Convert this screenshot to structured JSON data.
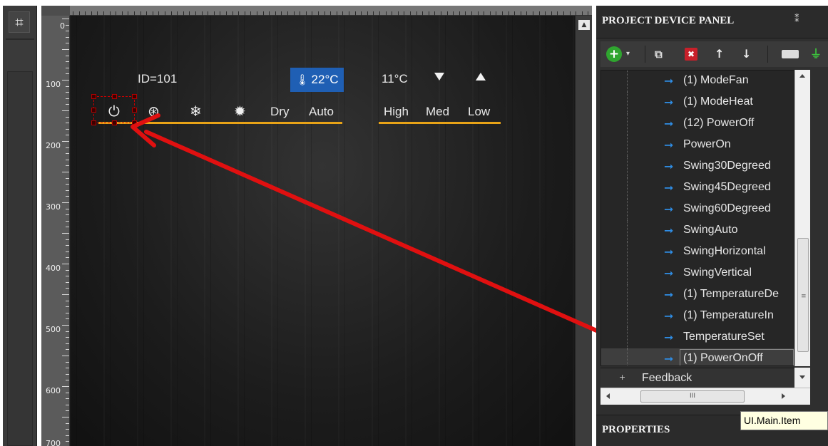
{
  "left_toolbar": {
    "fit_icon": "fit-to-screen-icon"
  },
  "ruler": {
    "zero": "0",
    "marks": [
      "100",
      "200",
      "300",
      "400",
      "500",
      "600",
      "700"
    ]
  },
  "canvas": {
    "device_id": "ID=101",
    "current_temp": "22°C",
    "set_temp": "11°C",
    "mode_buttons": [
      "Dry",
      "Auto"
    ],
    "fan_buttons": [
      "High",
      "Med",
      "Low"
    ],
    "icons": [
      "power-icon",
      "fan-icon",
      "snowflake-icon",
      "sun-icon",
      "thermometer-icon",
      "triangle-down-icon",
      "triangle-up-icon"
    ],
    "accent_color": "#e8a317",
    "temp_chip_color": "#1f5fb4",
    "arrow_color": "#e01010"
  },
  "right_panel": {
    "title": "PROJECT DEVICE PANEL",
    "toolbar": {
      "add": "+",
      "dropdown": "▾",
      "copy": "⧉",
      "delete": "✖",
      "up": "↑",
      "down": "↓"
    },
    "commands": [
      "(1) ModeFan",
      "(1) ModeHeat",
      "(12) PowerOff",
      "PowerOn",
      "Swing30Degreed",
      "Swing45Degreed",
      "Swing60Degreed",
      "SwingAuto",
      "SwingHorizontal",
      "SwingVertical",
      "(1) TemperatureDe",
      "(1) TemperatureIn",
      "TemperatureSet",
      "(1) PowerOnOff"
    ],
    "selected_command": "(1) PowerOnOff",
    "feedback_label": "Feedback",
    "hscroll_grip": "III",
    "vscroll_grip": "≡",
    "properties_title": "PROPERTIES"
  },
  "tooltip": "UI.Main.Item"
}
